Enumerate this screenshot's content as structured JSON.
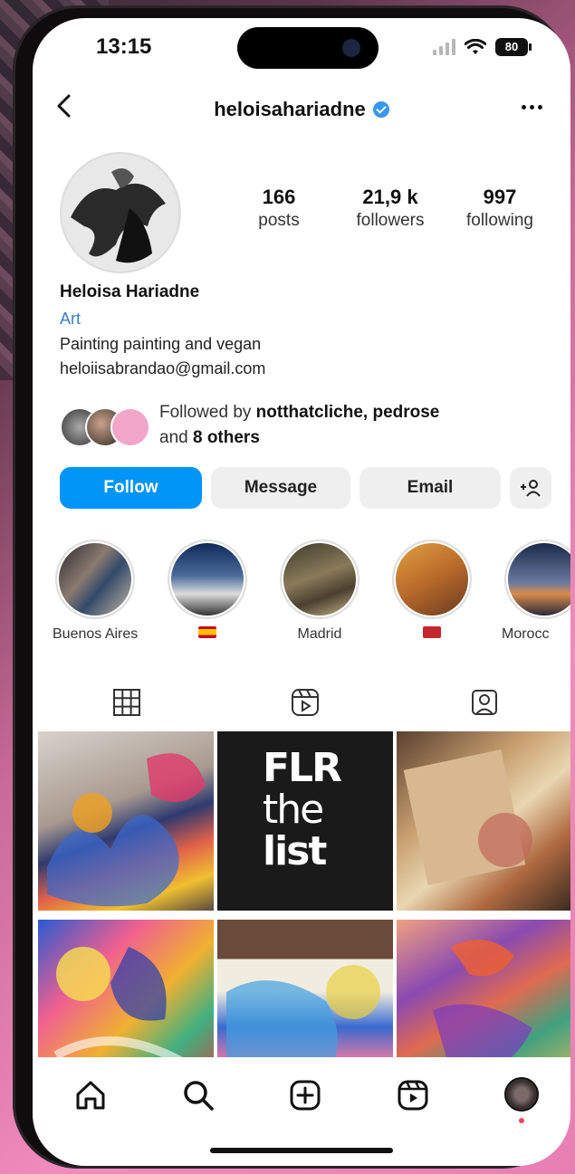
{
  "status_bar": {
    "time": "13:15",
    "battery": "80"
  },
  "header": {
    "username": "heloisahariadne"
  },
  "profile": {
    "stats": [
      {
        "value": "166",
        "label": "posts"
      },
      {
        "value": "21,9 k",
        "label": "followers"
      },
      {
        "value": "997",
        "label": "following"
      }
    ],
    "name": "Heloisa Hariadne",
    "category": "Art",
    "bio": "Painting painting and vegan",
    "email": "heloiisabrandao@gmail.com",
    "followed_by": {
      "prefix": "Followed by ",
      "names": "notthatcliche, pedrose",
      "and": "and ",
      "others": "8 others"
    }
  },
  "actions": {
    "follow": "Follow",
    "message": "Message",
    "email": "Email"
  },
  "highlights": [
    {
      "label": "Buenos Aires"
    },
    {
      "label": ""
    },
    {
      "label": "Madrid"
    },
    {
      "label": ""
    },
    {
      "label": "Morocc"
    }
  ],
  "tabs": [
    "grid",
    "reels",
    "tagged"
  ],
  "grid_text": {
    "post2_line1": "FLR",
    "post2_line2": "the",
    "post2_line3": "list"
  },
  "colors": {
    "accent": "#0095f6",
    "verified": "#3897f0"
  }
}
